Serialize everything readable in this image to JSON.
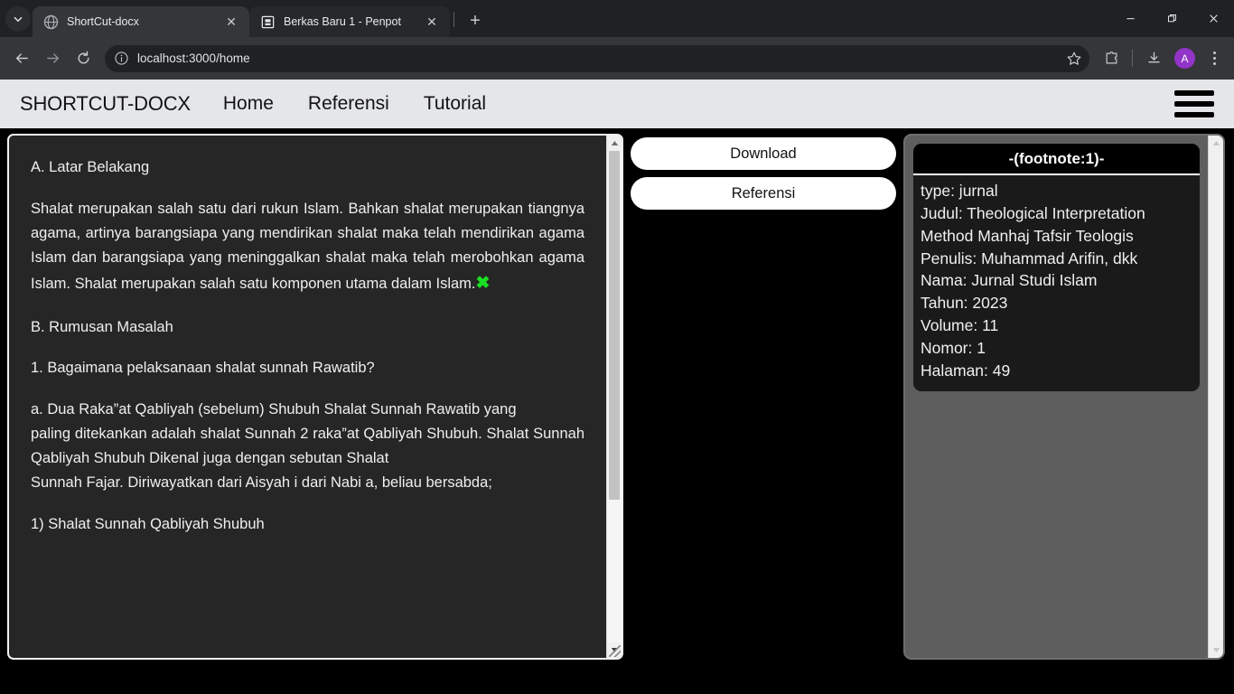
{
  "browser": {
    "tab_list_icon": "chevron-down-icon",
    "tabs": [
      {
        "title": "ShortCut-docx",
        "favicon": "globe-icon",
        "active": true,
        "close_label": "✕"
      },
      {
        "title": "Berkas Baru 1 - Penpot",
        "favicon": "penpot-icon",
        "active": false,
        "close_label": "✕"
      }
    ],
    "new_tab_label": "+",
    "window_controls": {
      "minimize": "minimize-icon",
      "maximize": "restore-icon",
      "close": "close-icon"
    },
    "toolbar": {
      "back": "back-arrow-icon",
      "forward": "forward-arrow-icon",
      "reload": "reload-icon",
      "site_info": "info-circle-icon",
      "url": "localhost:3000/home",
      "url_placeholder": "Search Google or type a URL",
      "bookmark": "star-icon",
      "extensions": "extensions-puzzle-icon",
      "downloads": "download-tray-icon",
      "profile_initial": "A",
      "menu": "kebab-menu-icon"
    }
  },
  "navbar": {
    "brand": "SHORTCUT-DOCX",
    "links": [
      {
        "label": "Home"
      },
      {
        "label": "Referensi"
      },
      {
        "label": "Tutorial"
      }
    ],
    "menu_icon": "hamburger-icon"
  },
  "document": {
    "paragraphs": [
      {
        "text": "A. Latar Belakang",
        "style": "plain"
      },
      {
        "text": "Shalat merupakan salah satu dari rukun Islam. Bahkan shalat merupakan tiangnya agama, artinya barangsiapa yang mendirikan shalat maka telah mendirikan agama Islam dan barangsiapa yang meninggalkan shalat maka telah merobohkan agama Islam. Shalat merupakan salah satu komponen utama dalam Islam.",
        "style": "justified",
        "marker": "✖"
      },
      {
        "text": "B. Rumusan Masalah",
        "style": "plain"
      },
      {
        "text": "1. Bagaimana pelaksanaan shalat sunnah Rawatib?",
        "style": "plain"
      },
      {
        "text": "a. Dua Raka”at Qabliyah (sebelum) Shubuh Shalat Sunnah Rawatib yang",
        "style": "justified"
      },
      {
        "text": "paling ditekankan adalah shalat Sunnah 2 raka”at Qabliyah Shubuh. Shalat Sunnah Qabliyah Shubuh Dikenal juga dengan sebutan Shalat",
        "style": "justified"
      },
      {
        "text": "Sunnah Fajar. Diriwayatkan dari Aisyah i dari Nabi a, beliau bersabda;",
        "style": "justified"
      },
      {
        "text": "1) Shalat Sunnah Qabliyah Shubuh",
        "style": "plain"
      }
    ],
    "marker_color": "#19e023",
    "scrollbar": {
      "up_arrow": "caret-up-icon",
      "down_arrow": "caret-down-icon",
      "resize_grip": "resize-grip-icon"
    }
  },
  "actions": {
    "buttons": [
      {
        "label": "Download"
      },
      {
        "label": "Referensi"
      }
    ]
  },
  "reference": {
    "card_title": "-(footnote:1)-",
    "fields": [
      "type: jurnal",
      "Judul: Theological Interpretation Method Manhaj Tafsir Teologis",
      "Penulis: Muhammad Arifin, dkk",
      "Nama: Jurnal Studi Islam",
      "Tahun: 2023",
      "Volume: 11",
      "Nomor: 1",
      "Halaman: 49"
    ],
    "scrollbar": {
      "up_arrow": "caret-up-icon",
      "down_arrow": "caret-down-icon"
    }
  }
}
